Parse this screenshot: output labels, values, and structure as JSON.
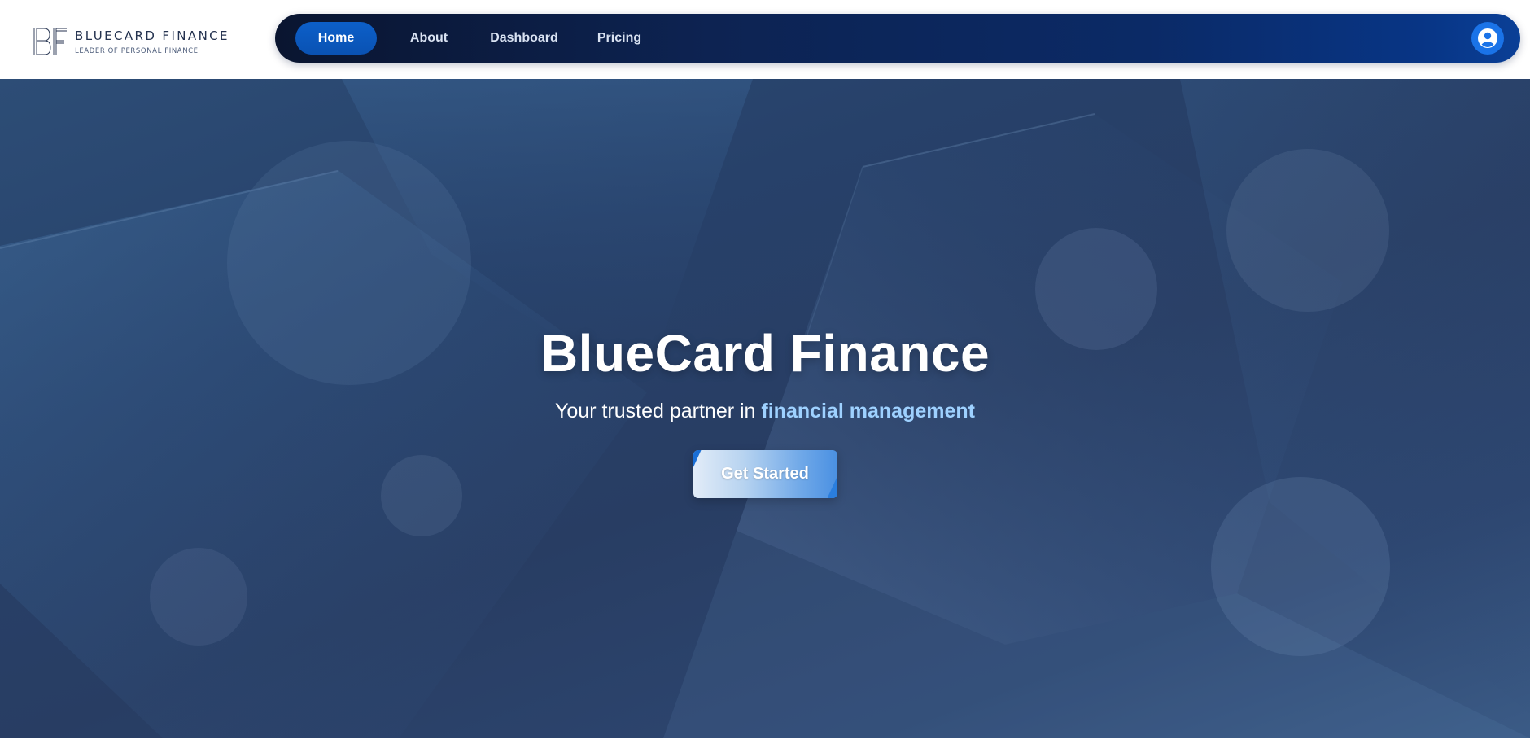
{
  "brand": {
    "name": "BLUECARD FINANCE",
    "tagline": "LEADER OF PERSONAL FINANCE",
    "monogram": "BF"
  },
  "nav": {
    "items": [
      {
        "label": "Home",
        "active": true
      },
      {
        "label": "About",
        "active": false
      },
      {
        "label": "Dashboard",
        "active": false
      },
      {
        "label": "Pricing",
        "active": false
      }
    ],
    "user_icon": "user-circle-icon"
  },
  "hero": {
    "title": "BlueCard Finance",
    "subtitle_prefix": "Your trusted partner in ",
    "subtitle_highlight": "financial management",
    "cta_label": "Get Started"
  },
  "colors": {
    "nav_active": "#0c5fc9",
    "accent": "#9ed1ff",
    "hero_bg": "#283d63",
    "user_button": "#1a73e8"
  }
}
